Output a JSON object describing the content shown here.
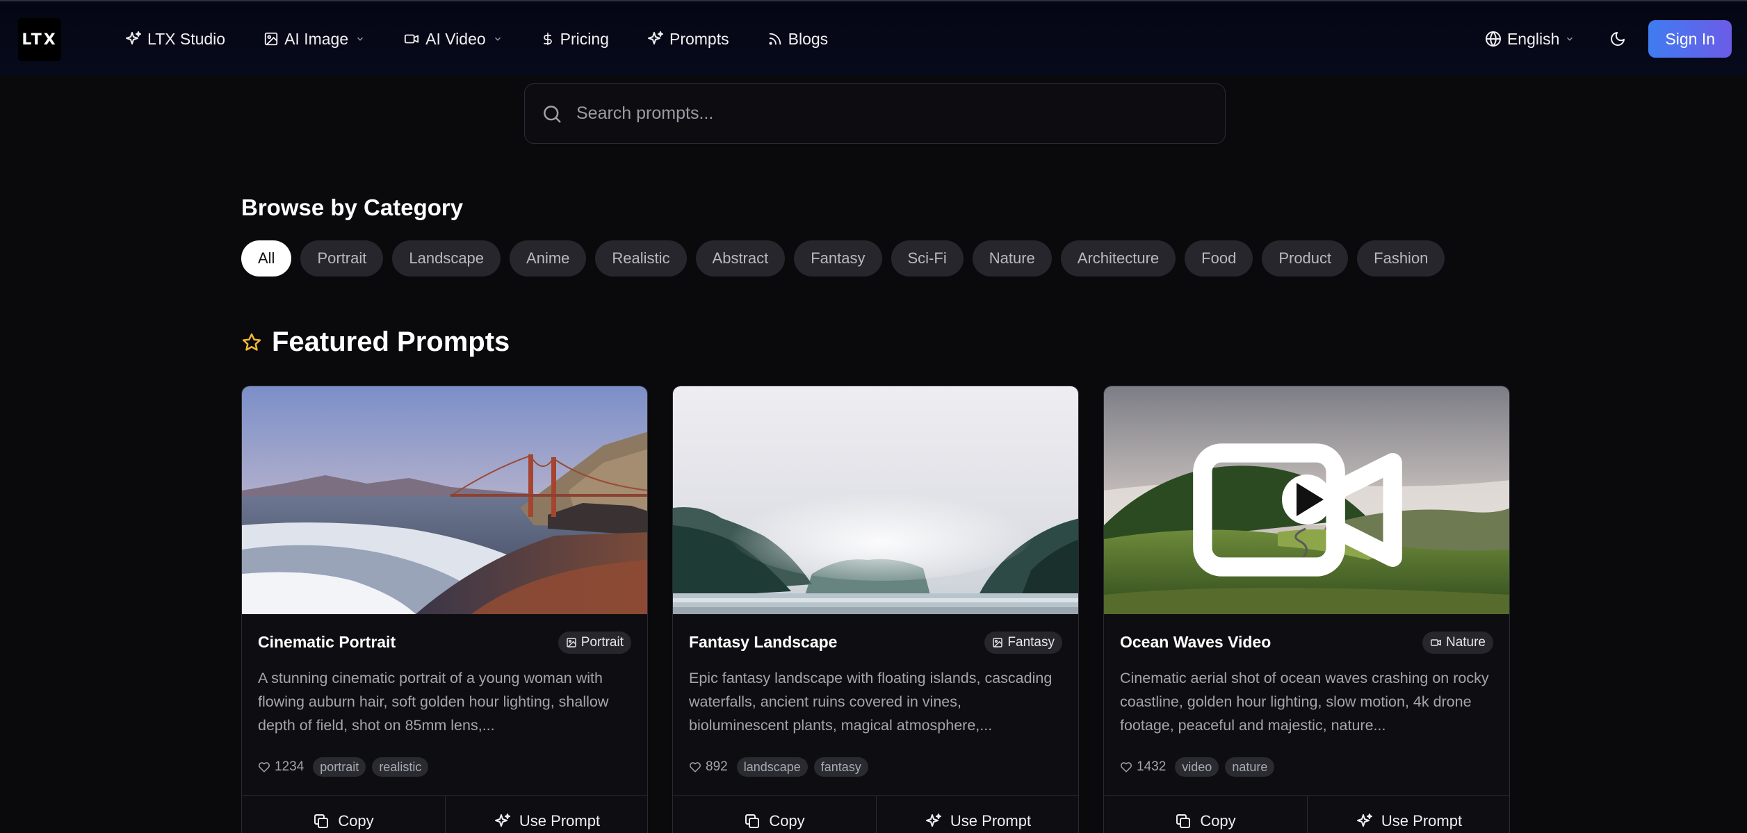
{
  "brand": {
    "logo_text": "LTX"
  },
  "nav": {
    "items": [
      {
        "label": "LTX Studio",
        "icon": "sparkles-icon"
      },
      {
        "label": "AI Image",
        "icon": "image-icon",
        "dropdown": true
      },
      {
        "label": "AI Video",
        "icon": "video-icon",
        "dropdown": true
      },
      {
        "label": "Pricing",
        "icon": "dollar-icon"
      },
      {
        "label": "Prompts",
        "icon": "sparkles-icon"
      },
      {
        "label": "Blogs",
        "icon": "rss-icon"
      }
    ],
    "language": "English",
    "theme_icon": "moon-icon",
    "sign_in": "Sign In"
  },
  "search": {
    "placeholder": "Search prompts...",
    "value": ""
  },
  "categories": {
    "title": "Browse by Category",
    "items": [
      "All",
      "Portrait",
      "Landscape",
      "Anime",
      "Realistic",
      "Abstract",
      "Fantasy",
      "Sci-Fi",
      "Nature",
      "Architecture",
      "Food",
      "Product",
      "Fashion"
    ],
    "selected": "All"
  },
  "featured": {
    "title": "Featured Prompts",
    "icon": "star-icon",
    "cards": [
      {
        "title": "Cinematic Portrait",
        "badge": "Portrait",
        "badge_icon": "image-icon",
        "description": "A stunning cinematic portrait of a young woman with flowing auburn hair, soft golden hour lighting, shallow depth of field, shot on 85mm lens,...",
        "likes": "1234",
        "tags": [
          "portrait",
          "realistic"
        ],
        "copy_label": "Copy",
        "use_label": "Use Prompt",
        "media": "image"
      },
      {
        "title": "Fantasy Landscape",
        "badge": "Fantasy",
        "badge_icon": "image-icon",
        "description": "Epic fantasy landscape with floating islands, cascading waterfalls, ancient ruins covered in vines, bioluminescent plants, magical atmosphere,...",
        "likes": "892",
        "tags": [
          "landscape",
          "fantasy"
        ],
        "copy_label": "Copy",
        "use_label": "Use Prompt",
        "media": "image"
      },
      {
        "title": "Ocean Waves Video",
        "badge": "Nature",
        "badge_icon": "video-icon",
        "description": "Cinematic aerial shot of ocean waves crashing on rocky coastline, golden hour lighting, slow motion, 4k drone footage, peaceful and majestic, nature...",
        "likes": "1432",
        "tags": [
          "video",
          "nature"
        ],
        "copy_label": "Copy",
        "use_label": "Use Prompt",
        "media": "video"
      }
    ]
  },
  "colors": {
    "background": "#0a0a0d",
    "navbar": "#05081a",
    "accent_start": "#3f7cf0",
    "accent_end": "#6c5ce7",
    "star": "#f5b731"
  }
}
